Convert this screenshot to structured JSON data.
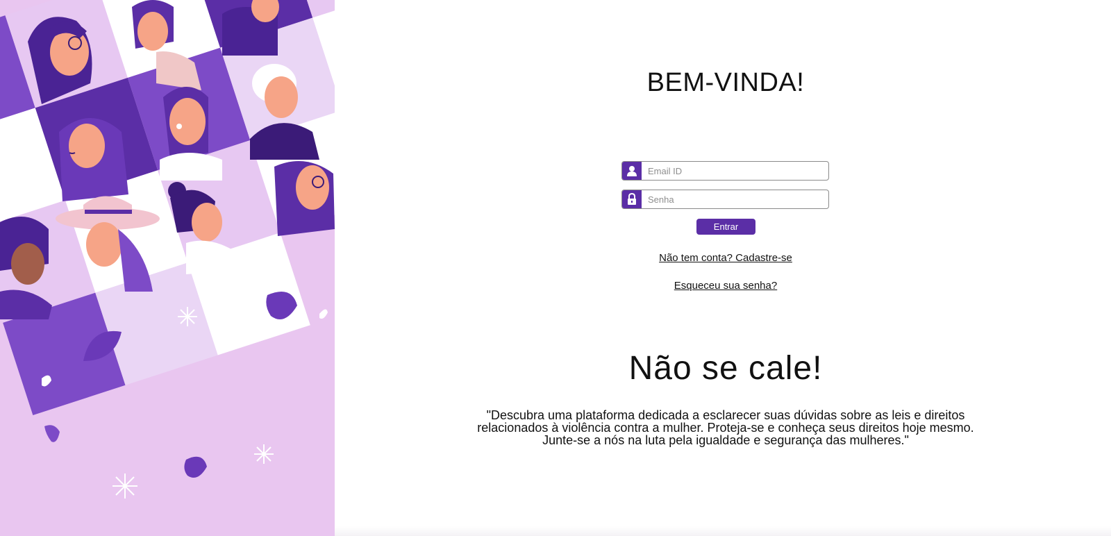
{
  "login": {
    "title": "BEM-VINDA!",
    "email_placeholder": "Email ID",
    "password_placeholder": "Senha",
    "submit_label": "Entrar",
    "signup_link": "Não tem conta? Cadastre-se",
    "forgot_link": "Esqueceu sua senha?"
  },
  "promo": {
    "slogan": "Não se cale!",
    "description": "\"Descubra uma plataforma dedicada a esclarecer suas dúvidas sobre as leis e direitos relacionados à violência contra a mulher. Proteja-se e conheça seus direitos hoje mesmo. Junte-se a nós na luta pela igualdade e segurança das mulheres.\""
  },
  "icons": {
    "email": "user-icon",
    "password": "lock-icon"
  },
  "colors": {
    "accent": "#5b2ea6",
    "art_background": "#e9c6f0",
    "text": "#111111"
  }
}
